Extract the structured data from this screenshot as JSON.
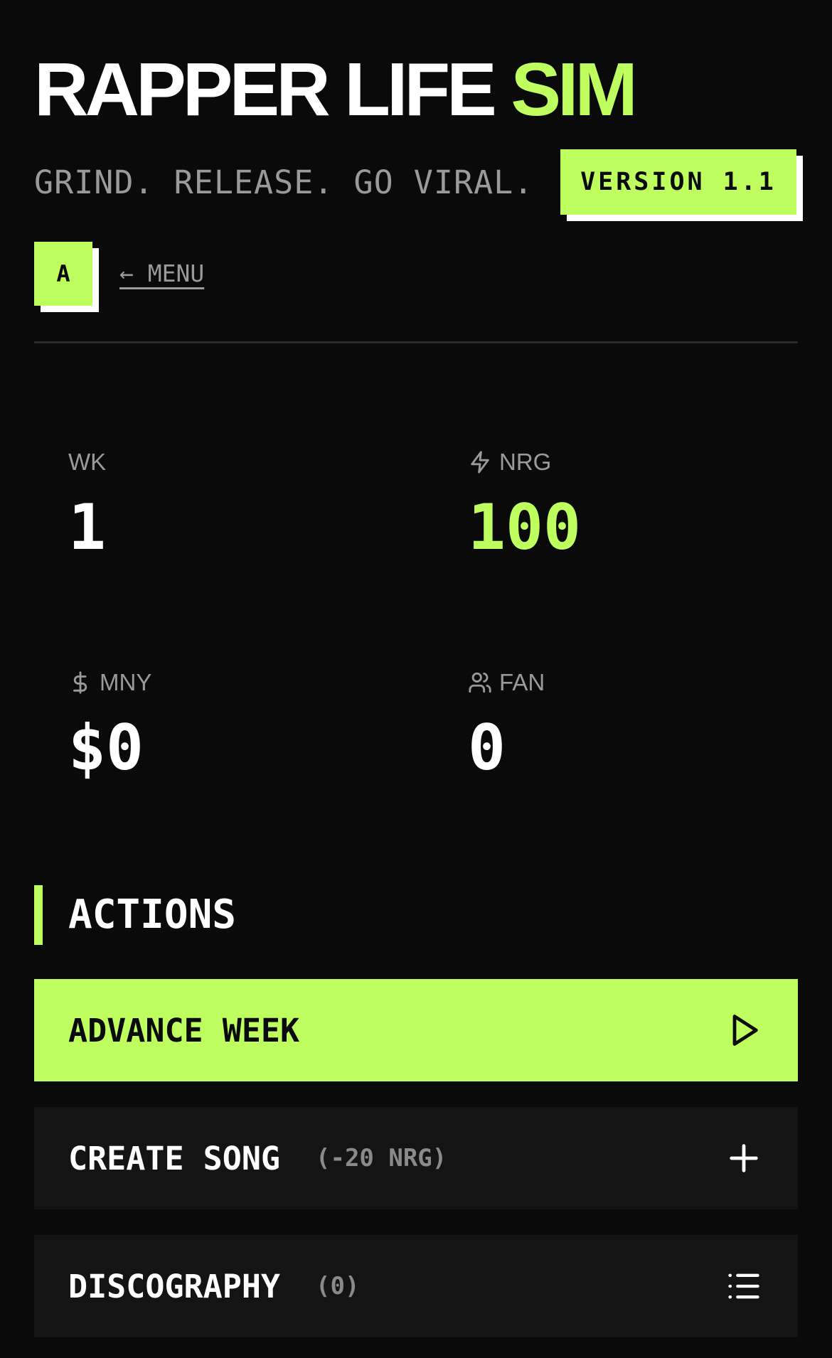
{
  "header": {
    "title_main": "RAPPER LIFE",
    "title_accent": "SIM",
    "tagline": "GRIND. RELEASE. GO VIRAL.",
    "version_badge": "VERSION 1.1"
  },
  "nav": {
    "avatar_letter": "A",
    "menu_link": "← MENU"
  },
  "stats": {
    "week": {
      "label": "WK",
      "value": "1"
    },
    "energy": {
      "label": "NRG",
      "value": "100",
      "icon": "lightning-icon"
    },
    "money": {
      "label": "MNY",
      "value": "$0",
      "icon": "dollar-icon"
    },
    "fans": {
      "label": "FAN",
      "value": "0",
      "icon": "users-icon"
    }
  },
  "actions": {
    "title": "ACTIONS",
    "advance": {
      "label": "ADVANCE WEEK",
      "icon": "play-icon"
    },
    "create": {
      "label": "CREATE SONG",
      "sub": "(-20 NRG)",
      "icon": "plus-icon"
    },
    "discography": {
      "label": "DISCOGRAPHY",
      "sub": "(0)",
      "icon": "list-icon"
    }
  },
  "colors": {
    "accent": "#bffe5f",
    "background": "#0a0a0a",
    "card": "#141414",
    "muted": "#9a9a9a"
  }
}
